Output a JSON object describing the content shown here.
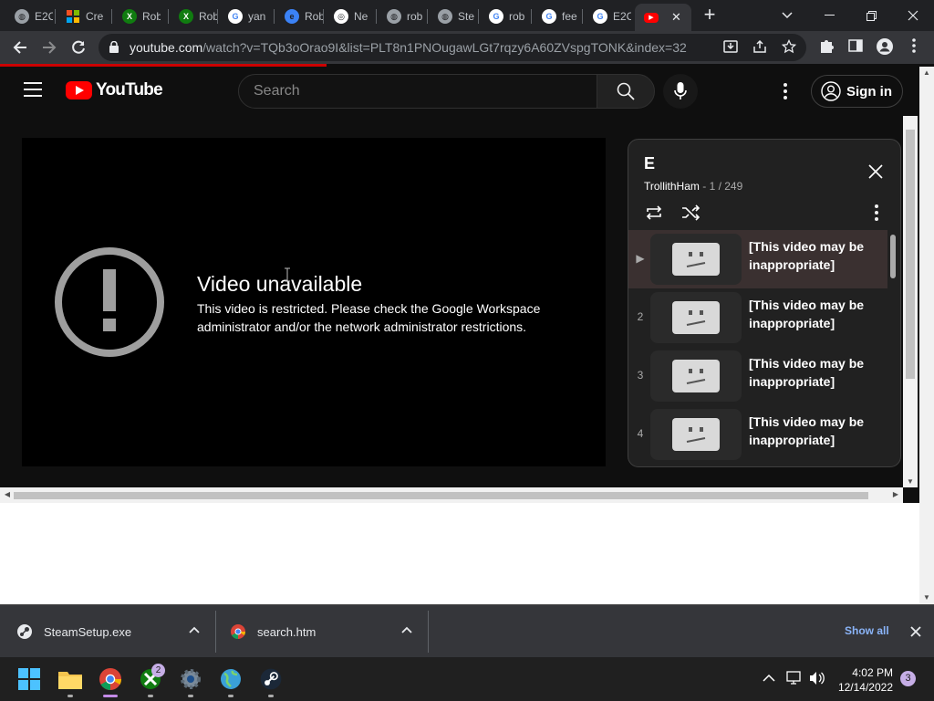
{
  "browser": {
    "tabs": [
      {
        "title": "E2C",
        "icon": "globe-icon",
        "color": "#9aa0a6"
      },
      {
        "title": "Cre",
        "icon": "microsoft-icon",
        "color": "#f25022"
      },
      {
        "title": "Rob",
        "icon": "xbox-icon",
        "color": "#107c10"
      },
      {
        "title": "Rob",
        "icon": "xbox-icon",
        "color": "#107c10"
      },
      {
        "title": "yan",
        "icon": "google-icon",
        "color": "#ffffff"
      },
      {
        "title": "Rob",
        "icon": "edge-icon",
        "color": "#3b82f6"
      },
      {
        "title": "Ne",
        "icon": "chrome-icon",
        "color": "#ffffff"
      },
      {
        "title": "rob",
        "icon": "globe-icon",
        "color": "#9aa0a6"
      },
      {
        "title": "Ste",
        "icon": "globe-icon",
        "color": "#9aa0a6"
      },
      {
        "title": "rob",
        "icon": "google-icon",
        "color": "#ffffff"
      },
      {
        "title": "fee",
        "icon": "google-icon",
        "color": "#ffffff"
      },
      {
        "title": "E2C",
        "icon": "google-icon",
        "color": "#ffffff"
      },
      {
        "title": "",
        "icon": "youtube-icon",
        "color": "#ff0000"
      }
    ],
    "url_host": "youtube.com",
    "url_path": "/watch?v=TQb3oOrao9I&list=PLT8n1PNOugawLGt7rqzy6A60ZVspgTONK&index=32"
  },
  "youtube": {
    "logo_text": "YouTube",
    "search_placeholder": "Search",
    "signin_label": "Sign in"
  },
  "player": {
    "error_title": "Video unavailable",
    "error_desc": "This video is restricted. Please check the Google Workspace administrator and/or the network administrator restrictions."
  },
  "playlist": {
    "title": "E",
    "owner": "TrollithHam",
    "position": "- 1 / 249",
    "items": [
      {
        "index": "▶",
        "title": "[This video may be inappropriate]"
      },
      {
        "index": "2",
        "title": "[This video may be inappropriate]"
      },
      {
        "index": "3",
        "title": "[This video may be inappropriate]"
      },
      {
        "index": "4",
        "title": "[This video may be inappropriate]"
      }
    ]
  },
  "downloads": {
    "items": [
      {
        "name": "SteamSetup.exe",
        "icon": "steam-icon"
      },
      {
        "name": "search.htm",
        "icon": "chrome-icon"
      }
    ],
    "show_all": "Show all"
  },
  "taskbar": {
    "xbox_badge": "2",
    "time": "4:02 PM",
    "date": "12/14/2022",
    "notifications": "3"
  },
  "colors": {
    "yt_red": "#ff0000",
    "link_blue": "#8ab4f8",
    "chrome_dark": "#202124"
  }
}
